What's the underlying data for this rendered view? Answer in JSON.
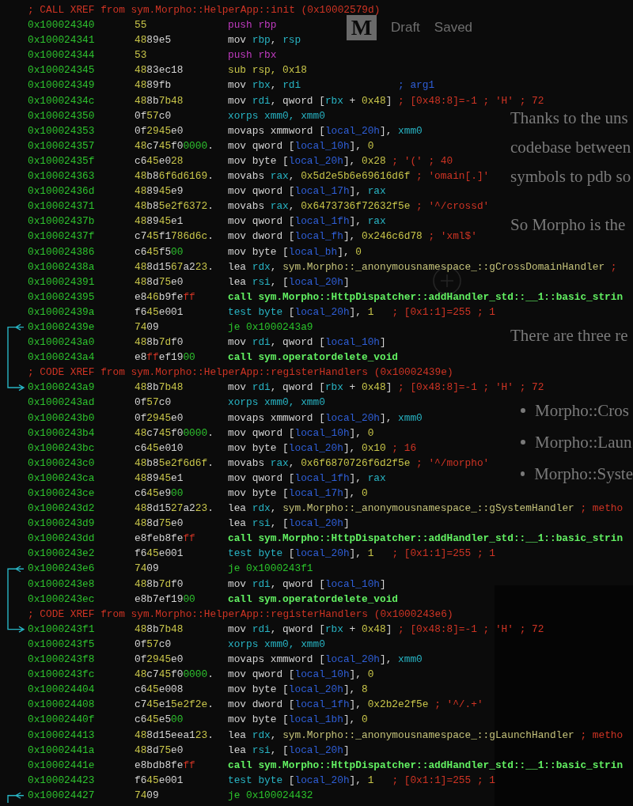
{
  "background_page": {
    "logo": "M",
    "status": [
      "Draft",
      "Saved"
    ],
    "paragraph_lines": [
      "Thanks to the uns",
      "codebase between",
      "symbols to pdb so"
    ],
    "paragraphs": [
      "So Morpho is the",
      "There are three re"
    ],
    "bullets": [
      "Morpho::Cros",
      "Morpho::Laun",
      "Morpho::Syste"
    ]
  },
  "disassembly": {
    "lines": [
      {
        "kind": "xref",
        "text": "; CALL XREF from sym.Morpho::HelperApp::init (0x10002579d)"
      },
      {
        "kind": "insn",
        "address": "0x100024340",
        "bytes": "55",
        "tokens": [
          {
            "kind": "push",
            "text": "push rbp"
          }
        ]
      },
      {
        "kind": "insn",
        "address": "0x100024341",
        "bytes": "4889e5",
        "tokens": [
          {
            "kind": "op",
            "text": "mov "
          },
          {
            "kind": "reg",
            "text": "rbp"
          },
          {
            "kind": "op",
            "text": ", "
          },
          {
            "kind": "reg",
            "text": "rsp"
          }
        ]
      },
      {
        "kind": "insn",
        "address": "0x100024344",
        "bytes": "53",
        "tokens": [
          {
            "kind": "push",
            "text": "push rbx"
          }
        ]
      },
      {
        "kind": "insn",
        "address": "0x100024345",
        "bytes": "4883ec18",
        "tokens": [
          {
            "kind": "num",
            "text": "sub rsp, 0x18"
          }
        ]
      },
      {
        "kind": "insn",
        "address": "0x100024349",
        "bytes": "4889fb",
        "tokens": [
          {
            "kind": "op",
            "text": "mov "
          },
          {
            "kind": "reg",
            "text": "rbx"
          },
          {
            "kind": "op",
            "text": ", "
          },
          {
            "kind": "reg",
            "text": "rdi"
          },
          {
            "kind": "var",
            "text": "                ; arg1"
          }
        ]
      },
      {
        "kind": "insn",
        "address": "0x10002434c",
        "bytes": "488b7b48",
        "tokens": [
          {
            "kind": "op",
            "text": "mov "
          },
          {
            "kind": "reg",
            "text": "rdi"
          },
          {
            "kind": "op",
            "text": ", qword ["
          },
          {
            "kind": "reg",
            "text": "rbx"
          },
          {
            "kind": "op",
            "text": " + "
          },
          {
            "kind": "num",
            "text": "0x48"
          },
          {
            "kind": "op",
            "text": "] "
          },
          {
            "kind": "cmt",
            "text": "; [0x48:8]=-1 ; 'H' ; 72"
          }
        ]
      },
      {
        "kind": "insn",
        "address": "0x100024350",
        "bytes": "0f57c0",
        "tokens": [
          {
            "kind": "reg",
            "text": "xorps xmm0, xmm0"
          }
        ]
      },
      {
        "kind": "insn",
        "address": "0x100024353",
        "bytes": "0f2945e0",
        "tokens": [
          {
            "kind": "op",
            "text": "movaps xmmword ["
          },
          {
            "kind": "var",
            "text": "local_20h"
          },
          {
            "kind": "op",
            "text": "], "
          },
          {
            "kind": "reg",
            "text": "xmm0"
          }
        ]
      },
      {
        "kind": "insn",
        "address": "0x100024357",
        "bytes": "48c745f00000.",
        "tokens": [
          {
            "kind": "op",
            "text": "mov qword ["
          },
          {
            "kind": "var",
            "text": "local_10h"
          },
          {
            "kind": "op",
            "text": "], "
          },
          {
            "kind": "num",
            "text": "0"
          }
        ]
      },
      {
        "kind": "insn",
        "address": "0x10002435f",
        "bytes": "c645e028",
        "tokens": [
          {
            "kind": "op",
            "text": "mov byte ["
          },
          {
            "kind": "var",
            "text": "local_20h"
          },
          {
            "kind": "op",
            "text": "], "
          },
          {
            "kind": "num",
            "text": "0x28"
          },
          {
            "kind": "cmt",
            "text": " ; '(' ; 40"
          }
        ]
      },
      {
        "kind": "insn",
        "address": "0x100024363",
        "bytes": "48b86f6d6169.",
        "tokens": [
          {
            "kind": "op",
            "text": "movabs "
          },
          {
            "kind": "reg",
            "text": "rax"
          },
          {
            "kind": "op",
            "text": ", "
          },
          {
            "kind": "num",
            "text": "0x5d2e5b6e69616d6f"
          },
          {
            "kind": "cmt",
            "text": " ; 'omain[.]'"
          }
        ]
      },
      {
        "kind": "insn",
        "address": "0x10002436d",
        "bytes": "488945e9",
        "tokens": [
          {
            "kind": "op",
            "text": "mov qword ["
          },
          {
            "kind": "var",
            "text": "local_17h"
          },
          {
            "kind": "op",
            "text": "], "
          },
          {
            "kind": "reg",
            "text": "rax"
          }
        ]
      },
      {
        "kind": "insn",
        "address": "0x100024371",
        "bytes": "48b85e2f6372.",
        "tokens": [
          {
            "kind": "op",
            "text": "movabs "
          },
          {
            "kind": "reg",
            "text": "rax"
          },
          {
            "kind": "op",
            "text": ", "
          },
          {
            "kind": "num",
            "text": "0x6473736f72632f5e"
          },
          {
            "kind": "cmt",
            "text": " ; '^/crossd'"
          }
        ]
      },
      {
        "kind": "insn",
        "address": "0x10002437b",
        "bytes": "488945e1",
        "tokens": [
          {
            "kind": "op",
            "text": "mov qword ["
          },
          {
            "kind": "var",
            "text": "local_1fh"
          },
          {
            "kind": "op",
            "text": "], "
          },
          {
            "kind": "reg",
            "text": "rax"
          }
        ]
      },
      {
        "kind": "insn",
        "address": "0x10002437f",
        "bytes": "c745f1786d6c.",
        "tokens": [
          {
            "kind": "op",
            "text": "mov dword ["
          },
          {
            "kind": "var",
            "text": "local_fh"
          },
          {
            "kind": "op",
            "text": "], "
          },
          {
            "kind": "num",
            "text": "0x246c6d78"
          },
          {
            "kind": "cmt",
            "text": " ; 'xml$'"
          }
        ]
      },
      {
        "kind": "insn",
        "address": "0x100024386",
        "bytes": "c645f500",
        "tokens": [
          {
            "kind": "op",
            "text": "mov byte ["
          },
          {
            "kind": "var",
            "text": "local_bh"
          },
          {
            "kind": "op",
            "text": "], "
          },
          {
            "kind": "num",
            "text": "0"
          }
        ]
      },
      {
        "kind": "insn",
        "address": "0x10002438a",
        "bytes": "488d1567a223.",
        "tokens": [
          {
            "kind": "op",
            "text": "lea "
          },
          {
            "kind": "reg",
            "text": "rdx"
          },
          {
            "kind": "op",
            "text": ", "
          },
          {
            "kind": "sym",
            "text": "sym.Morpho::_anonymousnamespace_::gCrossDomainHandler"
          },
          {
            "kind": "cmt",
            "text": " ;"
          }
        ]
      },
      {
        "kind": "insn",
        "address": "0x100024391",
        "bytes": "488d75e0",
        "tokens": [
          {
            "kind": "op",
            "text": "lea "
          },
          {
            "kind": "reg",
            "text": "rsi"
          },
          {
            "kind": "op",
            "text": ", ["
          },
          {
            "kind": "var",
            "text": "local_20h"
          },
          {
            "kind": "op",
            "text": "]"
          }
        ]
      },
      {
        "kind": "insn",
        "address": "0x100024395",
        "bytes": "e846b9feff",
        "tokens": [
          {
            "kind": "call",
            "text": "call sym.Morpho::HttpDispatcher::addHandler_std::__1::basic_strin"
          }
        ]
      },
      {
        "kind": "insn",
        "address": "0x10002439a",
        "bytes": "f645e001",
        "tokens": [
          {
            "kind": "reg",
            "text": "test byte "
          },
          {
            "kind": "op",
            "text": "["
          },
          {
            "kind": "var",
            "text": "local_20h"
          },
          {
            "kind": "op",
            "text": "], "
          },
          {
            "kind": "num",
            "text": "1"
          },
          {
            "kind": "cmt",
            "text": "   ; [0x1:1]=255 ; 1"
          }
        ]
      },
      {
        "kind": "insn",
        "address": "0x10002439e",
        "bytes": "7409",
        "jump_from": true,
        "tokens": [
          {
            "kind": "jmp",
            "text": "je 0x1000243a9"
          }
        ]
      },
      {
        "kind": "insn",
        "address": "0x1000243a0",
        "bytes": "488b7df0",
        "tokens": [
          {
            "kind": "op",
            "text": "mov "
          },
          {
            "kind": "reg",
            "text": "rdi"
          },
          {
            "kind": "op",
            "text": ", qword ["
          },
          {
            "kind": "var",
            "text": "local_10h"
          },
          {
            "kind": "op",
            "text": "]"
          }
        ]
      },
      {
        "kind": "insn",
        "address": "0x1000243a4",
        "bytes": "e8ffef1900",
        "tokens": [
          {
            "kind": "call",
            "text": "call sym.operatordelete_void"
          }
        ]
      },
      {
        "kind": "xref",
        "text": "; CODE XREF from sym.Morpho::HelperApp::registerHandlers (0x10002439e)"
      },
      {
        "kind": "insn",
        "address": "0x1000243a9",
        "bytes": "488b7b48",
        "jump_to": true,
        "tokens": [
          {
            "kind": "op",
            "text": "mov "
          },
          {
            "kind": "reg",
            "text": "rdi"
          },
          {
            "kind": "op",
            "text": ", qword ["
          },
          {
            "kind": "reg",
            "text": "rbx"
          },
          {
            "kind": "op",
            "text": " + "
          },
          {
            "kind": "num",
            "text": "0x48"
          },
          {
            "kind": "op",
            "text": "] "
          },
          {
            "kind": "cmt",
            "text": "; [0x48:8]=-1 ; 'H' ; 72"
          }
        ]
      },
      {
        "kind": "insn",
        "address": "0x1000243ad",
        "bytes": "0f57c0",
        "tokens": [
          {
            "kind": "reg",
            "text": "xorps xmm0, xmm0"
          }
        ]
      },
      {
        "kind": "insn",
        "address": "0x1000243b0",
        "bytes": "0f2945e0",
        "tokens": [
          {
            "kind": "op",
            "text": "movaps xmmword ["
          },
          {
            "kind": "var",
            "text": "local_20h"
          },
          {
            "kind": "op",
            "text": "], "
          },
          {
            "kind": "reg",
            "text": "xmm0"
          }
        ]
      },
      {
        "kind": "insn",
        "address": "0x1000243b4",
        "bytes": "48c745f00000.",
        "tokens": [
          {
            "kind": "op",
            "text": "mov qword ["
          },
          {
            "kind": "var",
            "text": "local_10h"
          },
          {
            "kind": "op",
            "text": "], "
          },
          {
            "kind": "num",
            "text": "0"
          }
        ]
      },
      {
        "kind": "insn",
        "address": "0x1000243bc",
        "bytes": "c645e010",
        "tokens": [
          {
            "kind": "op",
            "text": "mov byte ["
          },
          {
            "kind": "var",
            "text": "local_20h"
          },
          {
            "kind": "op",
            "text": "], "
          },
          {
            "kind": "num",
            "text": "0x10"
          },
          {
            "kind": "cmt",
            "text": " ; 16"
          }
        ]
      },
      {
        "kind": "insn",
        "address": "0x1000243c0",
        "bytes": "48b85e2f6d6f.",
        "tokens": [
          {
            "kind": "op",
            "text": "movabs "
          },
          {
            "kind": "reg",
            "text": "rax"
          },
          {
            "kind": "op",
            "text": ", "
          },
          {
            "kind": "num",
            "text": "0x6f6870726f6d2f5e"
          },
          {
            "kind": "cmt",
            "text": " ; '^/morpho'"
          }
        ]
      },
      {
        "kind": "insn",
        "address": "0x1000243ca",
        "bytes": "488945e1",
        "tokens": [
          {
            "kind": "op",
            "text": "mov qword ["
          },
          {
            "kind": "var",
            "text": "local_1fh"
          },
          {
            "kind": "op",
            "text": "], "
          },
          {
            "kind": "reg",
            "text": "rax"
          }
        ]
      },
      {
        "kind": "insn",
        "address": "0x1000243ce",
        "bytes": "c645e900",
        "tokens": [
          {
            "kind": "op",
            "text": "mov byte ["
          },
          {
            "kind": "var",
            "text": "local_17h"
          },
          {
            "kind": "op",
            "text": "], "
          },
          {
            "kind": "num",
            "text": "0"
          }
        ]
      },
      {
        "kind": "insn",
        "address": "0x1000243d2",
        "bytes": "488d1527a223.",
        "tokens": [
          {
            "kind": "op",
            "text": "lea "
          },
          {
            "kind": "reg",
            "text": "rdx"
          },
          {
            "kind": "op",
            "text": ", "
          },
          {
            "kind": "sym",
            "text": "sym.Morpho::_anonymousnamespace_::gSystemHandler"
          },
          {
            "kind": "cmt",
            "text": " ; metho"
          }
        ]
      },
      {
        "kind": "insn",
        "address": "0x1000243d9",
        "bytes": "488d75e0",
        "tokens": [
          {
            "kind": "op",
            "text": "lea "
          },
          {
            "kind": "reg",
            "text": "rsi"
          },
          {
            "kind": "op",
            "text": ", ["
          },
          {
            "kind": "var",
            "text": "local_20h"
          },
          {
            "kind": "op",
            "text": "]"
          }
        ]
      },
      {
        "kind": "insn",
        "address": "0x1000243dd",
        "bytes": "e8feb8feff",
        "tokens": [
          {
            "kind": "call",
            "text": "call sym.Morpho::HttpDispatcher::addHandler_std::__1::basic_strin"
          }
        ]
      },
      {
        "kind": "insn",
        "address": "0x1000243e2",
        "bytes": "f645e001",
        "tokens": [
          {
            "kind": "reg",
            "text": "test byte "
          },
          {
            "kind": "op",
            "text": "["
          },
          {
            "kind": "var",
            "text": "local_20h"
          },
          {
            "kind": "op",
            "text": "], "
          },
          {
            "kind": "num",
            "text": "1"
          },
          {
            "kind": "cmt",
            "text": "   ; [0x1:1]=255 ; 1"
          }
        ]
      },
      {
        "kind": "insn",
        "address": "0x1000243e6",
        "bytes": "7409",
        "jump_from": true,
        "tokens": [
          {
            "kind": "jmp",
            "text": "je 0x1000243f1"
          }
        ]
      },
      {
        "kind": "insn",
        "address": "0x1000243e8",
        "bytes": "488b7df0",
        "tokens": [
          {
            "kind": "op",
            "text": "mov "
          },
          {
            "kind": "reg",
            "text": "rdi"
          },
          {
            "kind": "op",
            "text": ", qword ["
          },
          {
            "kind": "var",
            "text": "local_10h"
          },
          {
            "kind": "op",
            "text": "]"
          }
        ]
      },
      {
        "kind": "insn",
        "address": "0x1000243ec",
        "bytes": "e8b7ef1900",
        "tokens": [
          {
            "kind": "call",
            "text": "call sym.operatordelete_void"
          }
        ]
      },
      {
        "kind": "xref",
        "text": "; CODE XREF from sym.Morpho::HelperApp::registerHandlers (0x1000243e6)"
      },
      {
        "kind": "insn",
        "address": "0x1000243f1",
        "bytes": "488b7b48",
        "jump_to": true,
        "tokens": [
          {
            "kind": "op",
            "text": "mov "
          },
          {
            "kind": "reg",
            "text": "rdi"
          },
          {
            "kind": "op",
            "text": ", qword ["
          },
          {
            "kind": "reg",
            "text": "rbx"
          },
          {
            "kind": "op",
            "text": " + "
          },
          {
            "kind": "num",
            "text": "0x48"
          },
          {
            "kind": "op",
            "text": "] "
          },
          {
            "kind": "cmt",
            "text": "; [0x48:8]=-1 ; 'H' ; 72"
          }
        ]
      },
      {
        "kind": "insn",
        "address": "0x1000243f5",
        "bytes": "0f57c0",
        "tokens": [
          {
            "kind": "reg",
            "text": "xorps xmm0, xmm0"
          }
        ]
      },
      {
        "kind": "insn",
        "address": "0x1000243f8",
        "bytes": "0f2945e0",
        "tokens": [
          {
            "kind": "op",
            "text": "movaps xmmword ["
          },
          {
            "kind": "var",
            "text": "local_20h"
          },
          {
            "kind": "op",
            "text": "], "
          },
          {
            "kind": "reg",
            "text": "xmm0"
          }
        ]
      },
      {
        "kind": "insn",
        "address": "0x1000243fc",
        "bytes": "48c745f00000.",
        "tokens": [
          {
            "kind": "op",
            "text": "mov qword ["
          },
          {
            "kind": "var",
            "text": "local_10h"
          },
          {
            "kind": "op",
            "text": "], "
          },
          {
            "kind": "num",
            "text": "0"
          }
        ]
      },
      {
        "kind": "insn",
        "address": "0x100024404",
        "bytes": "c645e008",
        "tokens": [
          {
            "kind": "op",
            "text": "mov byte ["
          },
          {
            "kind": "var",
            "text": "local_20h"
          },
          {
            "kind": "op",
            "text": "], "
          },
          {
            "kind": "num",
            "text": "8"
          }
        ]
      },
      {
        "kind": "insn",
        "address": "0x100024408",
        "bytes": "c745e15e2f2e.",
        "tokens": [
          {
            "kind": "op",
            "text": "mov dword ["
          },
          {
            "kind": "var",
            "text": "local_1fh"
          },
          {
            "kind": "op",
            "text": "], "
          },
          {
            "kind": "num",
            "text": "0x2b2e2f5e"
          },
          {
            "kind": "cmt",
            "text": " ; '^/.+'"
          }
        ]
      },
      {
        "kind": "insn",
        "address": "0x10002440f",
        "bytes": "c645e500",
        "tokens": [
          {
            "kind": "op",
            "text": "mov byte ["
          },
          {
            "kind": "var",
            "text": "local_1bh"
          },
          {
            "kind": "op",
            "text": "], "
          },
          {
            "kind": "num",
            "text": "0"
          }
        ]
      },
      {
        "kind": "insn",
        "address": "0x100024413",
        "bytes": "488d15eea123.",
        "tokens": [
          {
            "kind": "op",
            "text": "lea "
          },
          {
            "kind": "reg",
            "text": "rdx"
          },
          {
            "kind": "op",
            "text": ", "
          },
          {
            "kind": "sym",
            "text": "sym.Morpho::_anonymousnamespace_::gLaunchHandler"
          },
          {
            "kind": "cmt",
            "text": " ; metho"
          }
        ]
      },
      {
        "kind": "insn",
        "address": "0x10002441a",
        "bytes": "488d75e0",
        "tokens": [
          {
            "kind": "op",
            "text": "lea "
          },
          {
            "kind": "reg",
            "text": "rsi"
          },
          {
            "kind": "op",
            "text": ", ["
          },
          {
            "kind": "var",
            "text": "local_20h"
          },
          {
            "kind": "op",
            "text": "]"
          }
        ]
      },
      {
        "kind": "insn",
        "address": "0x10002441e",
        "bytes": "e8bdb8feff",
        "tokens": [
          {
            "kind": "call",
            "text": "call sym.Morpho::HttpDispatcher::addHandler_std::__1::basic_strin"
          }
        ]
      },
      {
        "kind": "insn",
        "address": "0x100024423",
        "bytes": "f645e001",
        "tokens": [
          {
            "kind": "reg",
            "text": "test byte "
          },
          {
            "kind": "op",
            "text": "["
          },
          {
            "kind": "var",
            "text": "local_20h"
          },
          {
            "kind": "op",
            "text": "], "
          },
          {
            "kind": "num",
            "text": "1"
          },
          {
            "kind": "cmt",
            "text": "   ; [0x1:1]=255 ; 1"
          }
        ]
      },
      {
        "kind": "insn",
        "address": "0x100024427",
        "bytes": "7409",
        "jump_from": true,
        "tokens": [
          {
            "kind": "jmp",
            "text": "je 0x100024432"
          }
        ]
      }
    ]
  }
}
